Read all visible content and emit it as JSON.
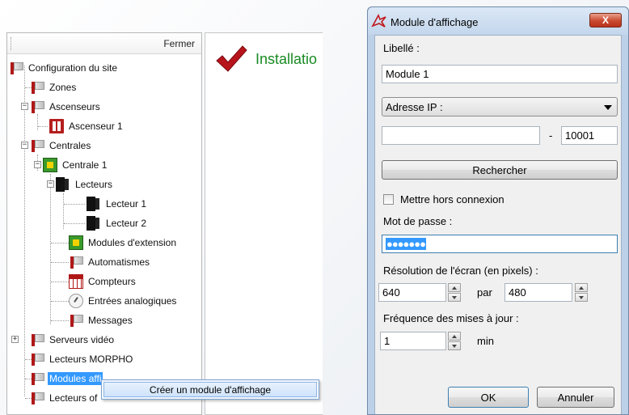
{
  "tree": {
    "close_label": "Fermer",
    "nodes": [
      {
        "label": "Configuration du site"
      },
      {
        "label": "Zones"
      },
      {
        "label": "Ascenseurs"
      },
      {
        "label": "Ascenseur 1"
      },
      {
        "label": "Centrales"
      },
      {
        "label": "Centrale 1"
      },
      {
        "label": "Lecteurs"
      },
      {
        "label": "Lecteur 1"
      },
      {
        "label": "Lecteur 2"
      },
      {
        "label": "Modules d'extension"
      },
      {
        "label": "Automatismes"
      },
      {
        "label": "Compteurs"
      },
      {
        "label": "Entrées analogiques"
      },
      {
        "label": "Messages"
      },
      {
        "label": "Serveurs vidéo"
      },
      {
        "label": "Lecteurs MORPHO"
      },
      {
        "label": "Modules affi"
      },
      {
        "label": "Lecteurs of"
      }
    ],
    "expander_minus": "−",
    "expander_plus": "+"
  },
  "content": {
    "title": "Installatio"
  },
  "context_menu": {
    "items": [
      {
        "label": "Créer un module d'affichage"
      }
    ]
  },
  "dialog": {
    "title": "Module d'affichage",
    "close_label": "X",
    "name_label": "Libellé :",
    "name_value": "Module 1",
    "address_type": "Adresse IP :",
    "ip_value": "",
    "dash": "-",
    "port_value": "10001",
    "search_button": "Rechercher",
    "offline_label": "Mettre hors connexion",
    "offline_checked": false,
    "password_label": "Mot de passe :",
    "password_mask": "●●●●●●●",
    "resolution_label": "Résolution de l'écran (en pixels) :",
    "width_value": "640",
    "by_label": "par",
    "height_value": "480",
    "frequency_label": "Fréquence des mises à jour :",
    "frequency_value": "1",
    "frequency_unit": "min",
    "ok_button": "OK",
    "cancel_button": "Annuler"
  },
  "colors": {
    "selection": "#3399ff",
    "title_green": "#1a8a24",
    "brand_red": "#b01818"
  }
}
